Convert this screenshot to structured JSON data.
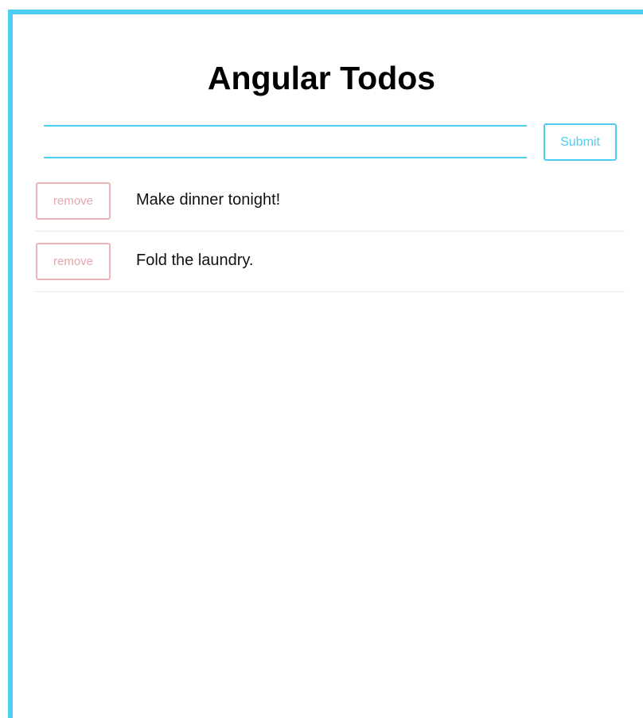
{
  "app": {
    "title": "Angular Todos"
  },
  "form": {
    "input_value": "",
    "input_placeholder": "",
    "submit_label": "Submit"
  },
  "todos": [
    {
      "remove_label": "remove",
      "text": "Make dinner tonight!"
    },
    {
      "remove_label": "remove",
      "text": "Fold the laundry."
    }
  ],
  "colors": {
    "accent": "#4ecdf2",
    "remove": "#e8b4b8",
    "divider": "#ebebeb"
  }
}
